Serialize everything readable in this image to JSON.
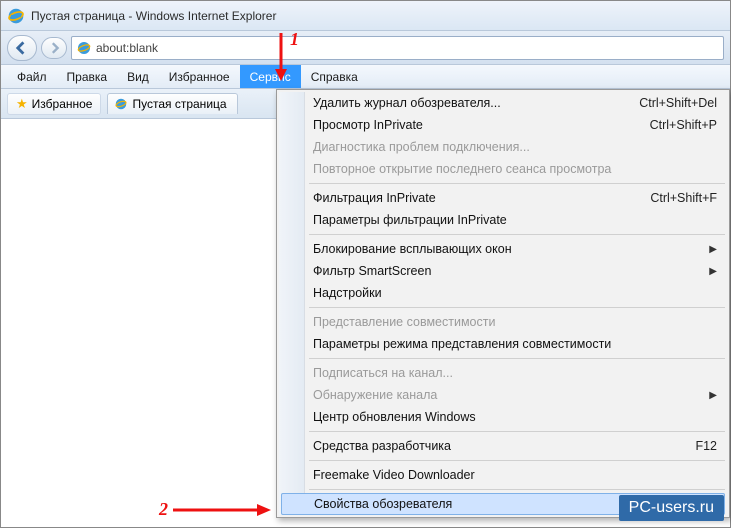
{
  "window": {
    "title": "Пустая страница - Windows Internet Explorer"
  },
  "address": {
    "url": "about:blank"
  },
  "menubar": {
    "items": [
      "Файл",
      "Правка",
      "Вид",
      "Избранное",
      "Сервис",
      "Справка"
    ],
    "active_index": 4
  },
  "favorites_btn": "Избранное",
  "tab": {
    "title": "Пустая страница"
  },
  "dropdown": {
    "groups": [
      [
        {
          "label": "Удалить журнал обозревателя...",
          "shortcut": "Ctrl+Shift+Del"
        },
        {
          "label": "Просмотр InPrivate",
          "shortcut": "Ctrl+Shift+P"
        },
        {
          "label": "Диагностика проблем подключения...",
          "disabled": true
        },
        {
          "label": "Повторное открытие последнего сеанса просмотра",
          "disabled": true
        }
      ],
      [
        {
          "label": "Фильтрация InPrivate",
          "shortcut": "Ctrl+Shift+F"
        },
        {
          "label": "Параметры фильтрации InPrivate"
        }
      ],
      [
        {
          "label": "Блокирование всплывающих окон",
          "submenu": true
        },
        {
          "label": "Фильтр SmartScreen",
          "submenu": true
        },
        {
          "label": "Надстройки"
        }
      ],
      [
        {
          "label": "Представление совместимости",
          "disabled": true
        },
        {
          "label": "Параметры режима представления совместимости"
        }
      ],
      [
        {
          "label": "Подписаться на канал...",
          "disabled": true
        },
        {
          "label": "Обнаружение канала",
          "disabled": true,
          "submenu": true
        },
        {
          "label": "Центр обновления Windows"
        }
      ],
      [
        {
          "label": "Средства разработчика",
          "shortcut": "F12"
        }
      ],
      [
        {
          "label": "Freemake Video Downloader"
        }
      ],
      [
        {
          "label": "Свойства обозревателя",
          "highlight": true
        }
      ]
    ]
  },
  "annotations": {
    "num1": "1",
    "num2": "2"
  },
  "watermark": "PC-users.ru"
}
